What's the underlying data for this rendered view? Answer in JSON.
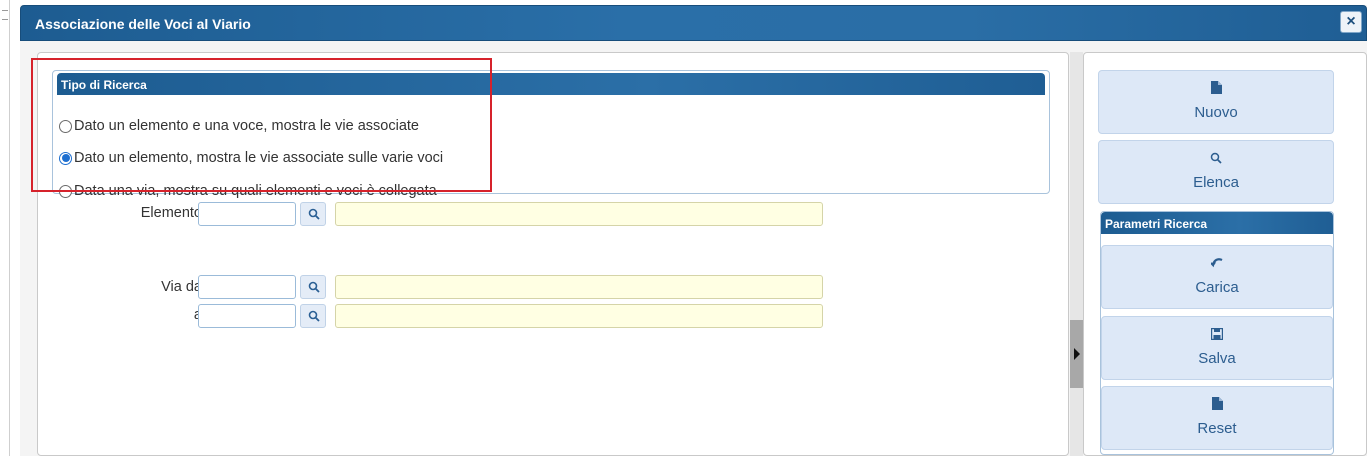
{
  "window": {
    "title": "Associazione delle Voci al Viario",
    "close_label": "×"
  },
  "search_type": {
    "legend": "Tipo di Ricerca",
    "options": [
      {
        "label": "Dato un elemento e una voce, mostra le vie associate",
        "checked": false
      },
      {
        "label": "Dato un elemento, mostra le vie associate sulle varie voci",
        "checked": true
      },
      {
        "label": "Data una via, mostra su quali elementi e voci è collegata",
        "checked": false
      }
    ]
  },
  "form": {
    "elemento_label": "Elemento",
    "via_da_label": "Via da",
    "a_label": "a"
  },
  "side": {
    "nuovo_label": "Nuovo",
    "elenca_label": "Elenca",
    "params_title": "Parametri Ricerca",
    "carica_label": "Carica",
    "salva_label": "Salva",
    "reset_label": "Reset"
  },
  "colors": {
    "header_blue": "#1d5c91",
    "highlight_red": "#d6222b",
    "description_field": "#ffffe3",
    "side_button": "#dde8f7"
  }
}
